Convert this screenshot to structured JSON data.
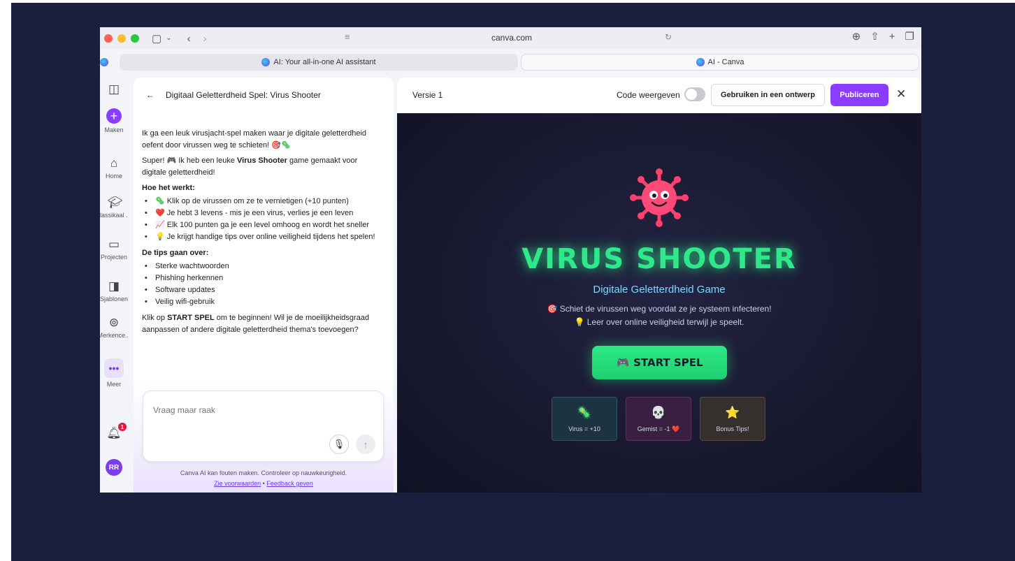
{
  "colors": {
    "slide_bg": "#1a1f3e",
    "accent_purple": "#8b3dff",
    "neon_green": "#2fe889",
    "subtitle_cyan": "#7fd8ff",
    "game_bg": "#1a1a32"
  },
  "browser": {
    "url": "canva.com",
    "tabs": [
      {
        "label": "AI: Your all-in-one AI assistant",
        "active": false
      },
      {
        "label": "AI - Canva",
        "active": true
      }
    ],
    "toolbar_icons": [
      "sidebar-icon",
      "chevron-down-icon",
      "back-icon",
      "forward-icon",
      "share-icon",
      "reload-icon",
      "download-icon",
      "share-up-icon",
      "new-tab-icon",
      "tabs-overview-icon"
    ]
  },
  "rail": {
    "items": [
      {
        "label": "Maken",
        "icon": "plus-icon"
      },
      {
        "label": "Home",
        "icon": "home-icon"
      },
      {
        "label": "lassikaal ...",
        "icon": "graduation-cap-icon"
      },
      {
        "label": "Projecten",
        "icon": "folder-icon"
      },
      {
        "label": "Sjablonen",
        "icon": "templates-icon"
      },
      {
        "label": "Merkence...",
        "icon": "brand-icon"
      },
      {
        "label": "Meer",
        "icon": "more-icon"
      }
    ],
    "notification_count": "1",
    "avatar_initials": "RR"
  },
  "chat": {
    "title": "Digitaal Geletterdheid Spel: Virus Shooter",
    "intro": "Ik ga een leuk virusjacht-spel maken waar je digitale geletterdheid oefent door virussen weg te schieten! 🎯🦠",
    "super_prefix": "Super! 🎮 Ik heb een leuke ",
    "super_bold": "Virus Shooter",
    "super_suffix": " game gemaakt voor digitale geletterdheid!",
    "how_heading": "Hoe het werkt:",
    "how_items": [
      "🦠 Klik op de virussen om ze te vernietigen (+10 punten)",
      "❤️ Je hebt 3 levens - mis je een virus, verlies je een leven",
      "📈 Elk 100 punten ga je een level omhoog en wordt het sneller",
      "💡 Je krijgt handige tips over online veiligheid tijdens het spelen!"
    ],
    "tips_heading": "De tips gaan over:",
    "tips_items": [
      "Sterke wachtwoorden",
      "Phishing herkennen",
      "Software updates",
      "Veilig wifi-gebruik"
    ],
    "closing_prefix": "Klik op ",
    "closing_bold": "START SPEL",
    "closing_suffix": " om te beginnen! Wil je de moeilijkheidsgraad aanpassen of andere digitale geletterdheid thema's toevoegen?",
    "input_placeholder": "Vraag maar raak",
    "disclaimer": "Canva AI kan fouten maken. Controleer op nauwkeurigheid.",
    "terms_link": "Zie voorwaarden",
    "separator": " • ",
    "feedback_link": "Feedback geven"
  },
  "preview": {
    "version": "Versie 1",
    "code_label": "Code weergeven",
    "code_toggle_on": false,
    "use_button": "Gebruiken in een ontwerp",
    "publish_button": "Publiceren",
    "game": {
      "title": "VIRUS SHOOTER",
      "subtitle": "Digitale Geletterdheid Game",
      "line1": "🎯 Schiet de virussen weg voordat ze je systeem infecteren!",
      "line2": "💡 Leer over online veiligheid terwijl je speelt.",
      "start_icon": "🎮",
      "start_label": "START SPEL",
      "cards": [
        {
          "icon": "🦠",
          "label": "Virus = +10"
        },
        {
          "icon": "💀",
          "label": "Gemist = -1 ❤️"
        },
        {
          "icon": "⭐",
          "label": "Bonus Tips!"
        }
      ]
    }
  }
}
